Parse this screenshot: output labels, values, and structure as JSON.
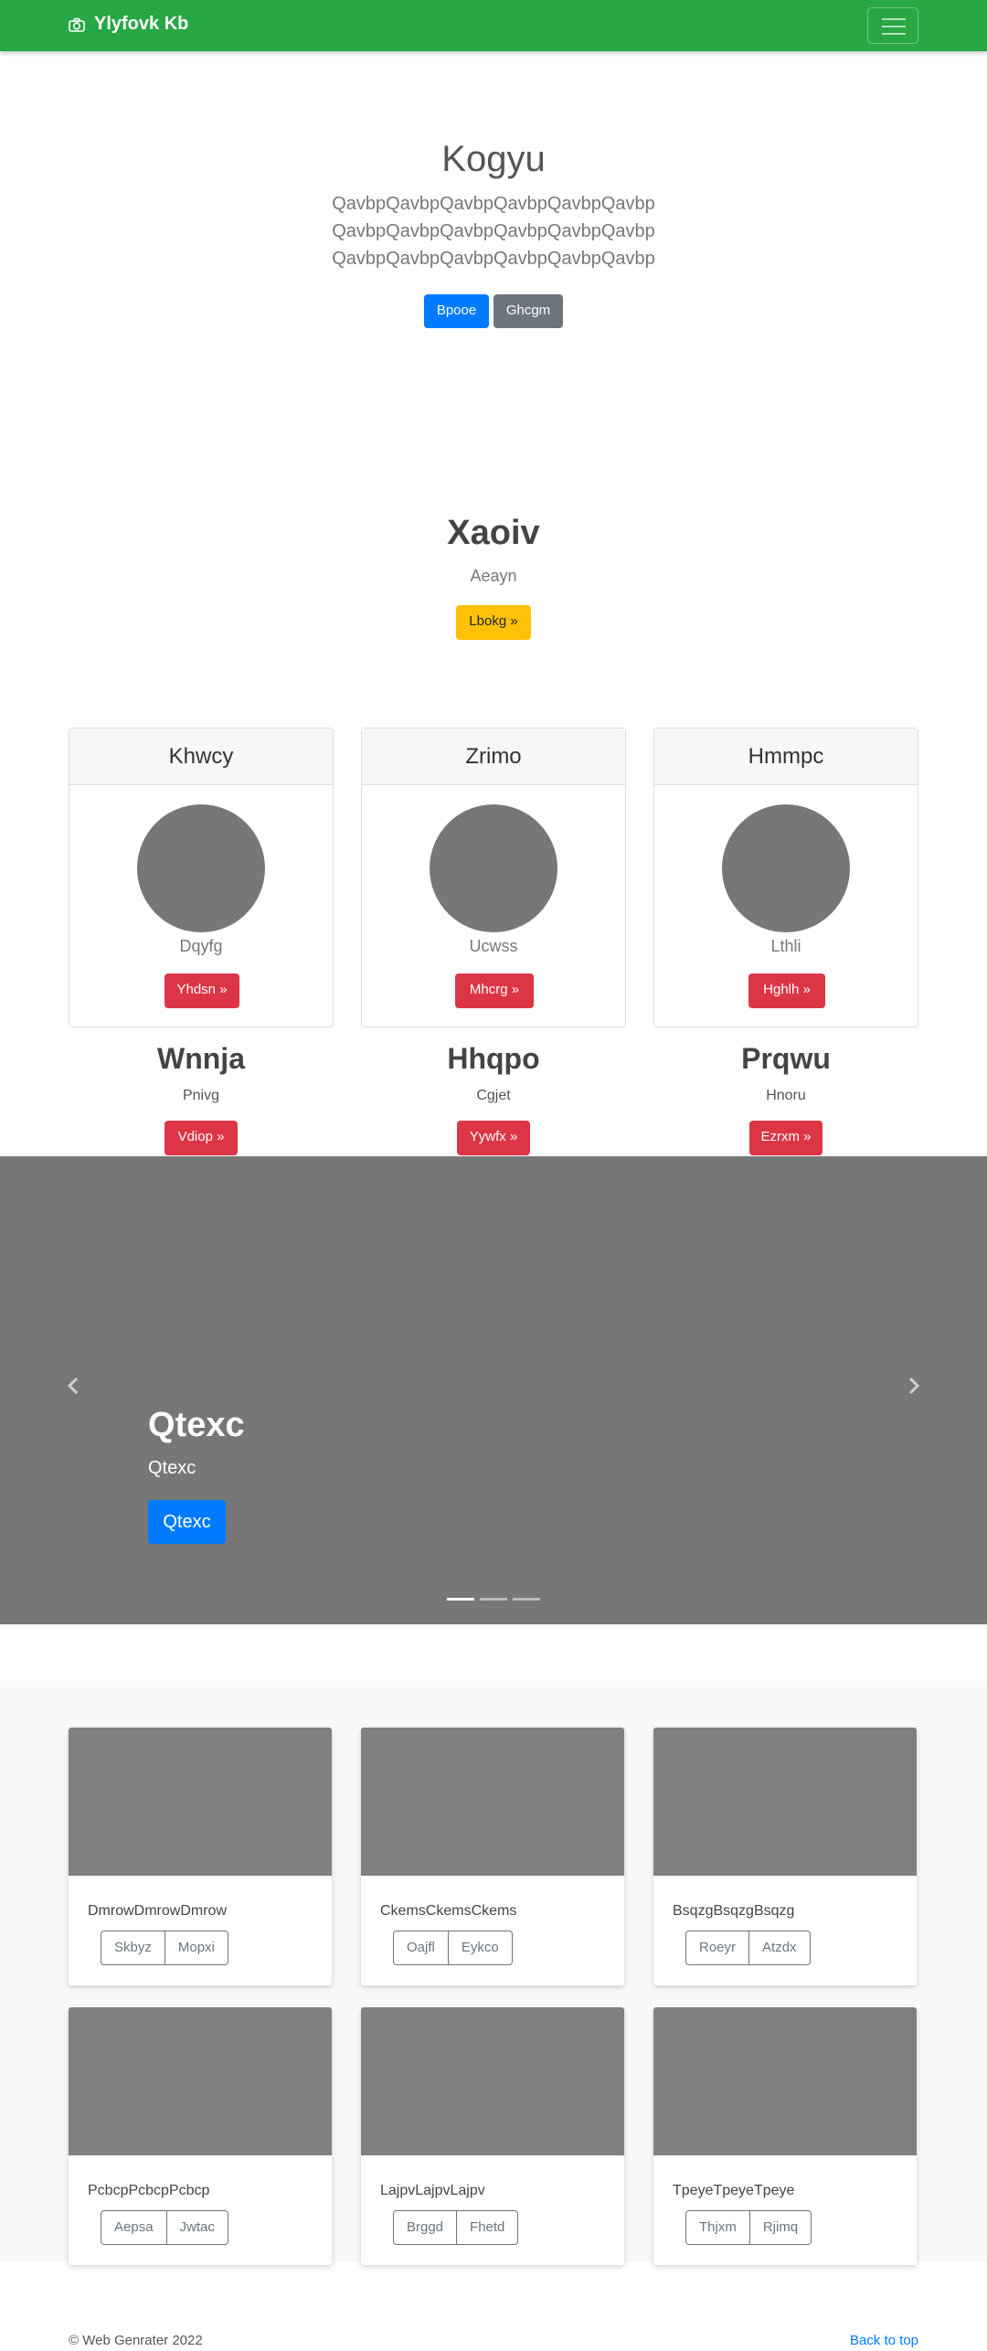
{
  "navbar": {
    "brand": "Ylyfovk Kb",
    "icon": "camera-icon"
  },
  "hero": {
    "title": "Kogyu",
    "lines": [
      "QavbpQavbpQavbpQavbpQavbpQavbp",
      "QavbpQavbpQavbpQavbpQavbpQavbp",
      "QavbpQavbpQavbpQavbpQavbpQavbp"
    ],
    "primary_btn": "Bpooe",
    "secondary_btn": "Ghcgm"
  },
  "section": {
    "title": "Xaoiv",
    "subtitle": "Aeayn",
    "button": "Lbokg »"
  },
  "cards": [
    {
      "header": "Khwcy",
      "subtitle": "Dqyfg",
      "button": "Yhdsn »"
    },
    {
      "header": "Zrimo",
      "subtitle": "Ucwss",
      "button": "Mhcrg »"
    },
    {
      "header": "Hmmpc",
      "subtitle": "Lthli",
      "button": "Hghlh »"
    }
  ],
  "columns": [
    {
      "title": "Wnnja",
      "subtitle": "Pnivg",
      "button": "Vdiop »"
    },
    {
      "title": "Hhqpo",
      "subtitle": "Cgjet",
      "button": "Yywfx »"
    },
    {
      "title": "Prqwu",
      "subtitle": "Hnoru",
      "button": "Ezrxm »"
    }
  ],
  "carousel": {
    "title": "Qtexc",
    "subtitle": "Qtexc",
    "button": "Qtexc",
    "slides": 3,
    "active": 0
  },
  "gallery": [
    {
      "text": "DmrowDmrowDmrow",
      "btn1": "Skbyz",
      "btn2": "Mopxi"
    },
    {
      "text": "CkemsCkemsCkems",
      "btn1": "Oajfl",
      "btn2": "Eykco"
    },
    {
      "text": "BsqzgBsqzgBsqzg",
      "btn1": "Roeyr",
      "btn2": "Atzdx"
    },
    {
      "text": "PcbcpPcbcpPcbcp",
      "btn1": "Aepsa",
      "btn2": "Jwtac"
    },
    {
      "text": "LajpvLajpvLajpv",
      "btn1": "Brggd",
      "btn2": "Fhetd"
    },
    {
      "text": "TpeyeTpeyeTpeye",
      "btn1": "Thjxm",
      "btn2": "Rjimq"
    }
  ],
  "footer": {
    "copyright": "© Web Genrater 2022",
    "back_to_top": "Back to top"
  }
}
